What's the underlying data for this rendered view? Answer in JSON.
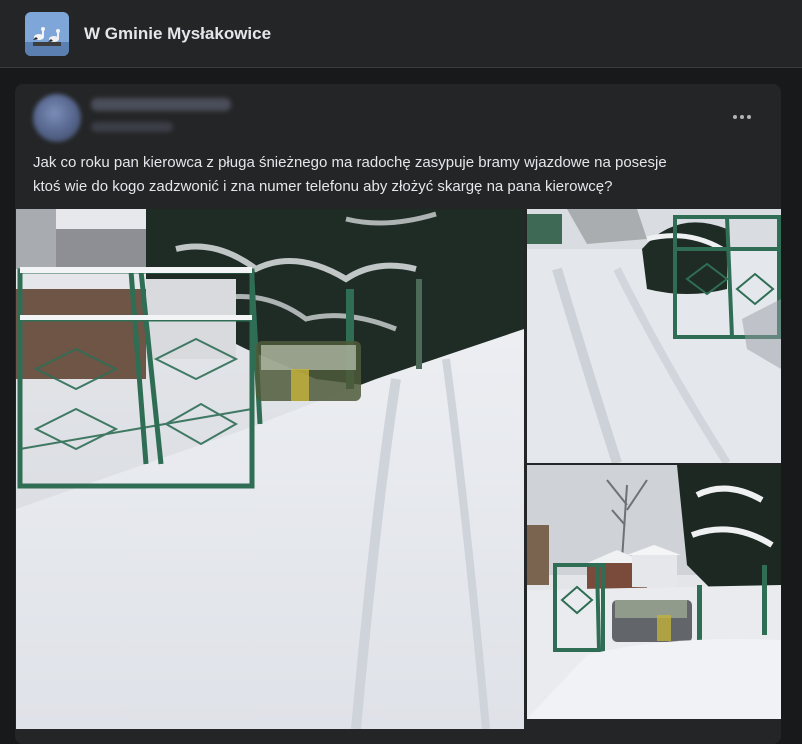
{
  "group": {
    "name": "W Gminie Mysłakowice",
    "avatar_icon": "group-avatar-storks"
  },
  "post": {
    "text_line1": "Jak co roku pan kierowca z pługa śnieżnego ma radochę zasypuje bramy wjazdowe na posesje",
    "text_line2": "ktoś wie do kogo zadzwonić i zna numer telefonu aby złożyć skargę na pana kierowcę?",
    "more_icon": "more-options-icon",
    "photos": [
      {
        "name": "photo-snowy-gate-main"
      },
      {
        "name": "photo-snowy-road-top-right"
      },
      {
        "name": "photo-snowy-gate-bottom-right"
      }
    ]
  },
  "colors": {
    "background": "#18191a",
    "surface": "#242526",
    "text": "#e4e6eb",
    "secondary": "#b0b3b8"
  }
}
